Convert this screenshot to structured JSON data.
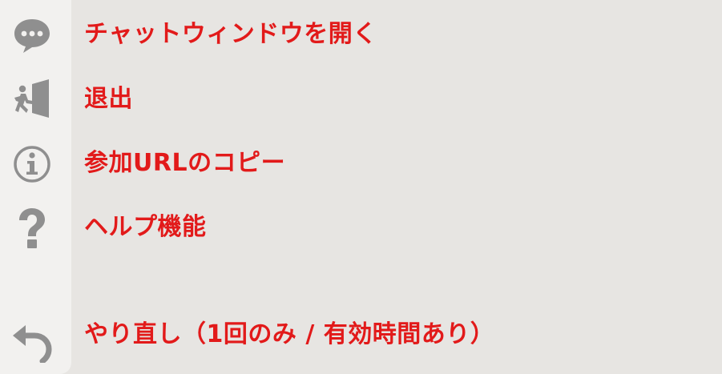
{
  "menu": {
    "items": [
      {
        "icon": "chat-bubble-icon",
        "label": "チャットウィンドウを開く"
      },
      {
        "icon": "exit-door-icon",
        "label": "退出"
      },
      {
        "icon": "info-icon",
        "label": "参加URLのコピー"
      },
      {
        "icon": "help-question-icon",
        "label": "ヘルプ機能"
      },
      {
        "icon": "undo-icon",
        "label": "やり直し（1回のみ / 有効時間あり）"
      }
    ]
  },
  "colors": {
    "label_text": "#e21a1a",
    "icon_gray": "#8f8f8f",
    "sidebar_bg": "#f2f1ef",
    "page_bg": "#e7e5e2"
  }
}
